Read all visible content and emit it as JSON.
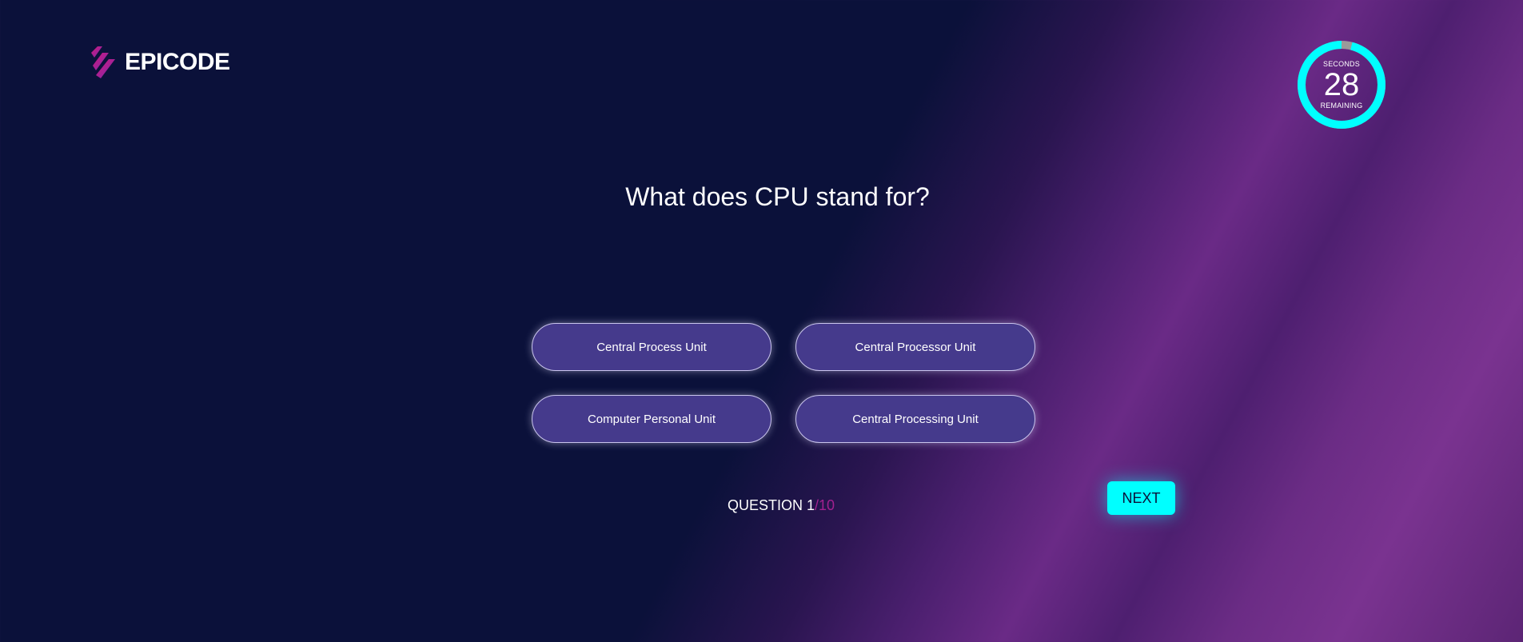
{
  "logo": {
    "text": "EPICODE",
    "icon": "epicode-stripes-icon",
    "colors": [
      "#d4177a",
      "#9c2aa8",
      "#5d2fb8"
    ]
  },
  "timer": {
    "label_top": "SECONDS",
    "value": "28",
    "label_bottom": "REMAINING",
    "remaining_fraction": 0.96,
    "ring_color": "#00ffff",
    "elapsed_color": "#9a9a9a"
  },
  "question": {
    "text": "What does CPU stand for?"
  },
  "answers": [
    {
      "label": "Central Process Unit"
    },
    {
      "label": "Central Processor Unit"
    },
    {
      "label": "Computer Personal Unit"
    },
    {
      "label": "Central Processing Unit"
    }
  ],
  "progress": {
    "prefix": "QUESTION 1",
    "total": "/10",
    "current": 1,
    "count": 10
  },
  "next_button": {
    "label": "NEXT"
  },
  "colors": {
    "background": "#0b113a",
    "accent": "#00ffff",
    "answer_fill": "#453a8c",
    "counter_total": "#a2218f"
  }
}
